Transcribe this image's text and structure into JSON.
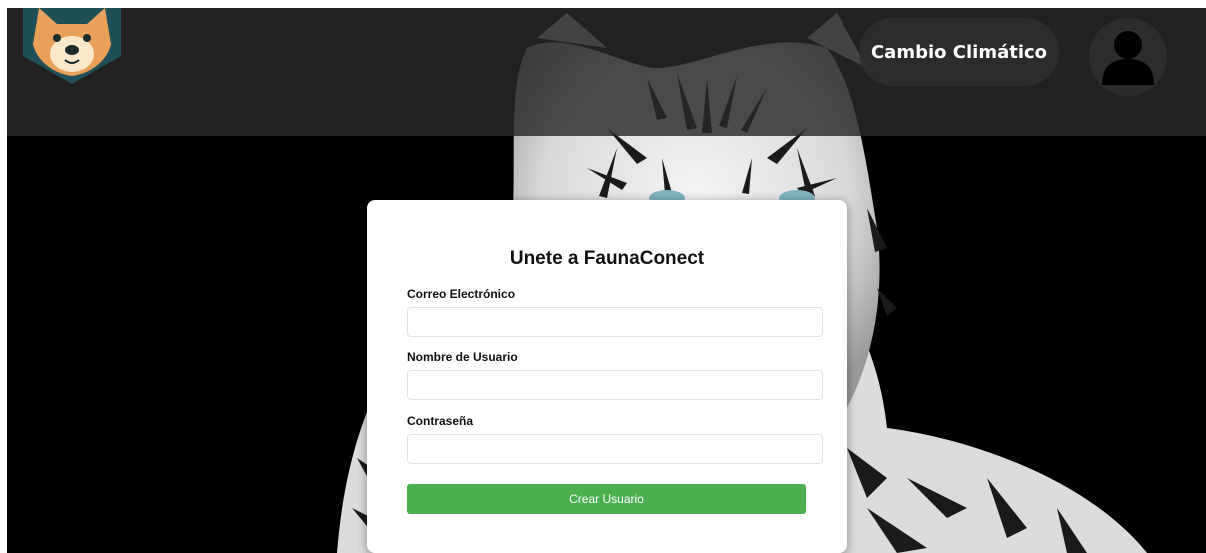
{
  "header": {
    "nav_link_label": "Cambio Climático",
    "profile_icon": "user-icon"
  },
  "logo": {
    "icon": "dog-face-logo-icon",
    "colors": {
      "shield": "#1f4f57",
      "face": "#e9a15a",
      "muzzle": "#fbe7c9"
    }
  },
  "background": {
    "icon": "white-tiger-image"
  },
  "form": {
    "title": "Unete a FaunaConect",
    "email_label": "Correo Electrónico",
    "email_value": "",
    "username_label": "Nombre de Usuario",
    "username_value": "",
    "password_label": "Contraseña",
    "password_value": "",
    "submit_label": "Crear Usuario"
  },
  "colors": {
    "accent": "#4caf50",
    "header_bg": "#282828",
    "page_bg": "#000000"
  }
}
